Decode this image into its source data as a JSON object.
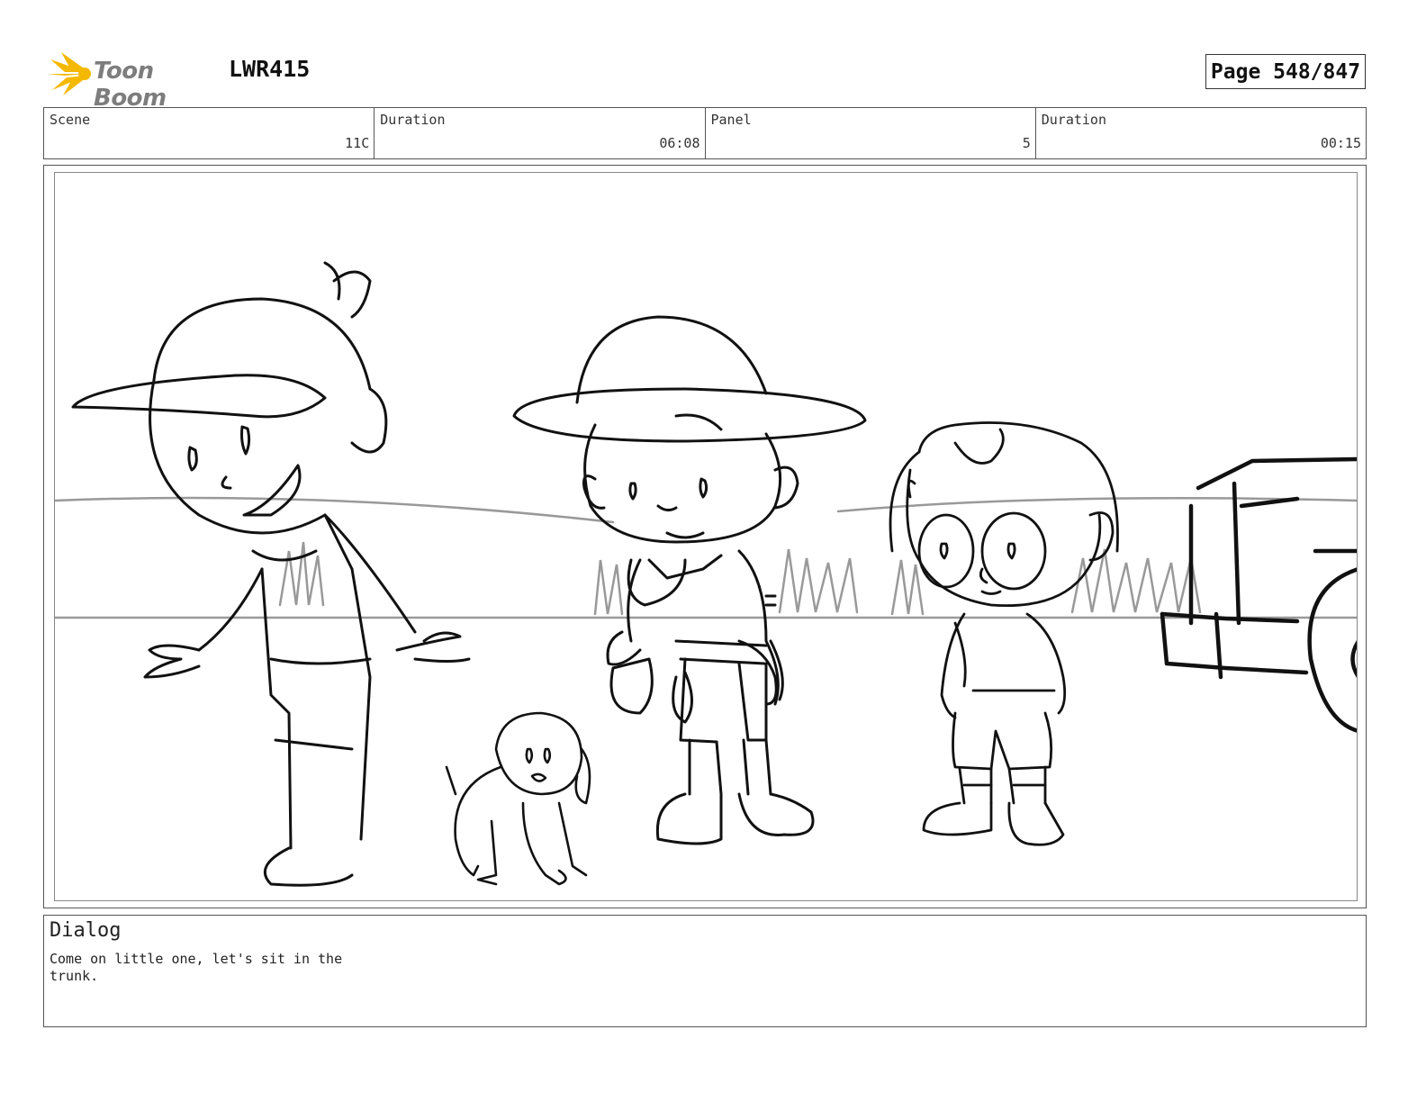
{
  "header": {
    "logo_text": "Toon Boom",
    "project_code": "LWR415",
    "page_label": "Page 548/847"
  },
  "info": {
    "scene_label": "Scene",
    "scene_value": "11C",
    "scene_duration_label": "Duration",
    "scene_duration_value": "06:08",
    "panel_label": "Panel",
    "panel_value": "5",
    "panel_duration_label": "Duration",
    "panel_duration_value": "00:15"
  },
  "dialog": {
    "title": "Dialog",
    "text": "Come on little one, let's sit in the trunk."
  },
  "colors": {
    "logo_yellow": "#f5b800",
    "logo_text": "#7d7d7d",
    "sketch_line": "#111111",
    "sketch_grey": "#999999"
  }
}
